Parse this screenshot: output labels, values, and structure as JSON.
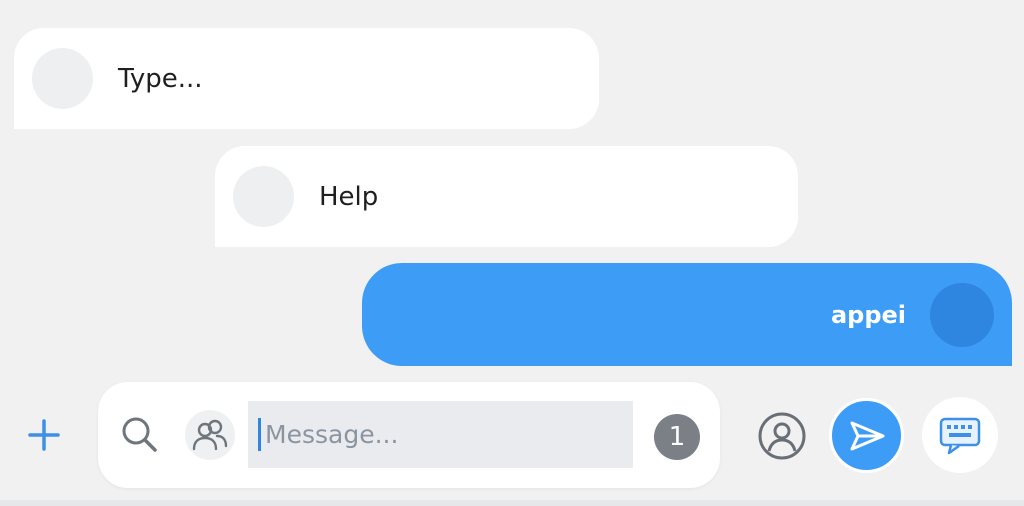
{
  "messages": [
    {
      "direction": "incoming",
      "text": "Type..."
    },
    {
      "direction": "incoming",
      "text": "Help"
    },
    {
      "direction": "outgoing",
      "text": "appei"
    }
  ],
  "composer": {
    "placeholder": "Message...",
    "badge_count": "1"
  },
  "icons": {
    "add": "plus-icon",
    "search": "search-icon",
    "contacts": "people-icon",
    "profile": "user-circle-icon",
    "send": "send-icon",
    "keyboard": "keyboard-icon"
  },
  "colors": {
    "accent": "#3d9cf5",
    "background": "#f1f1f2",
    "bubble_incoming": "#ffffff",
    "badge": "#7b8087"
  }
}
